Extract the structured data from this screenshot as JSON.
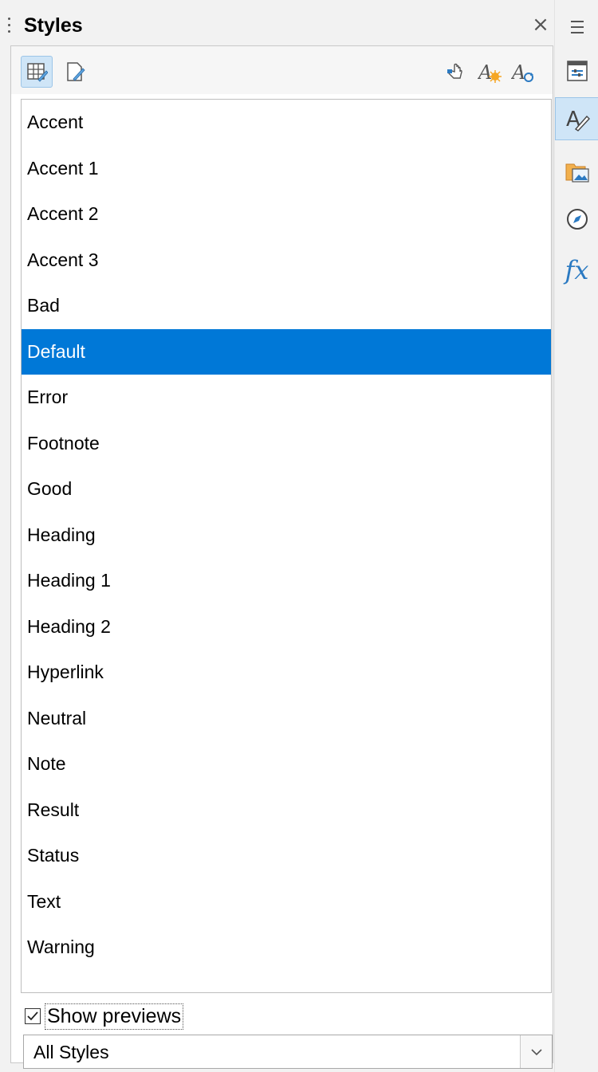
{
  "sidebar": {
    "title": "Styles",
    "close_glyph": "×",
    "toolbar_icons": [
      "cell-styles-icon",
      "page-styles-icon",
      "fill-format-mode-icon",
      "new-style-from-selection-icon",
      "update-style-icon"
    ],
    "styles": [
      "Accent",
      "Accent 1",
      "Accent 2",
      "Accent 3",
      "Bad",
      "Default",
      "Error",
      "Footnote",
      "Good",
      "Heading",
      "Heading 1",
      "Heading 2",
      "Hyperlink",
      "Neutral",
      "Note",
      "Result",
      "Status",
      "Text",
      "Warning"
    ],
    "selected_style": "Default",
    "show_previews_label": "Show previews",
    "show_previews_checked": true,
    "filter_value": "All Styles"
  },
  "tabbar": {
    "icons": [
      "properties-icon",
      "styles-icon",
      "gallery-icon",
      "navigator-icon",
      "functions-icon"
    ],
    "active": "styles-icon",
    "functions_glyph": "fx"
  },
  "colors": {
    "selection": "#0078d7",
    "accent_blue": "#2b7ac2",
    "active_tab": "#cfe5f7"
  }
}
